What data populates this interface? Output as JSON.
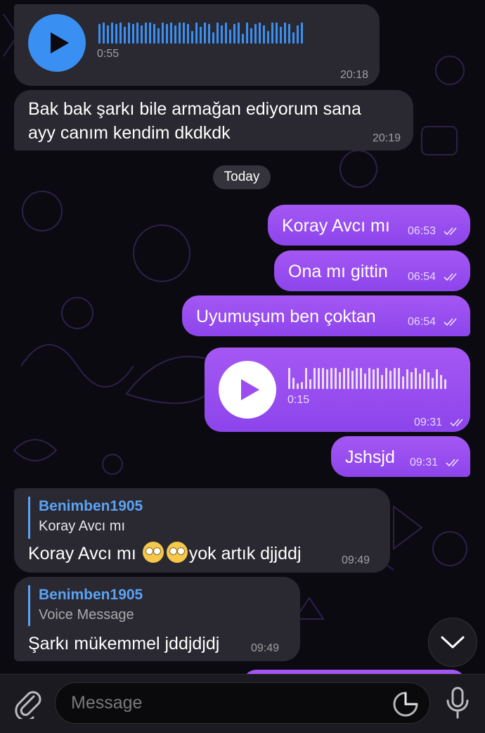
{
  "messages": {
    "voice_in": {
      "duration": "0:55",
      "time": "20:18"
    },
    "text_in_1": {
      "line1": "Bak bak şarkı bile armağan ediyorum sana",
      "line2": "ayy canım kendim dkdkdk",
      "time": "20:19"
    },
    "date_separator": "Today",
    "out_1": {
      "text": "Koray Avcı mı",
      "time": "06:53"
    },
    "out_2": {
      "text": "Ona mı gittin",
      "time": "06:54"
    },
    "out_3": {
      "text": "Uyumuşum ben çoktan",
      "time": "06:54"
    },
    "voice_out": {
      "duration": "0:15",
      "time": "09:31"
    },
    "out_4": {
      "text": "Jshsjd",
      "time": "09:31"
    },
    "reply_in_1": {
      "reply_name": "Benimben1905",
      "reply_quote": "Koray Avcı mı",
      "text_before": "Koray Avcı mı",
      "text_after": "yok artık djjddj",
      "time": "09:49"
    },
    "reply_in_2": {
      "reply_name": "Benimben1905",
      "reply_quote": "Voice Message",
      "text": "Şarkı mükemmel jddjdjdj",
      "time": "09:49"
    }
  },
  "composer": {
    "placeholder": "Message"
  },
  "icons": {
    "attach": "paperclip-icon",
    "sticker": "sticker-icon",
    "mic": "microphone-icon",
    "scroll": "chevron-down-icon",
    "play": "play-icon",
    "read": "double-check-icon"
  },
  "colors": {
    "incoming_bubble": "#2a2830",
    "outgoing_bubble": "#9b4df0",
    "play_button_in": "#3a8ff2",
    "reply_accent": "#5aa3f5",
    "background": "#0b0a10"
  }
}
